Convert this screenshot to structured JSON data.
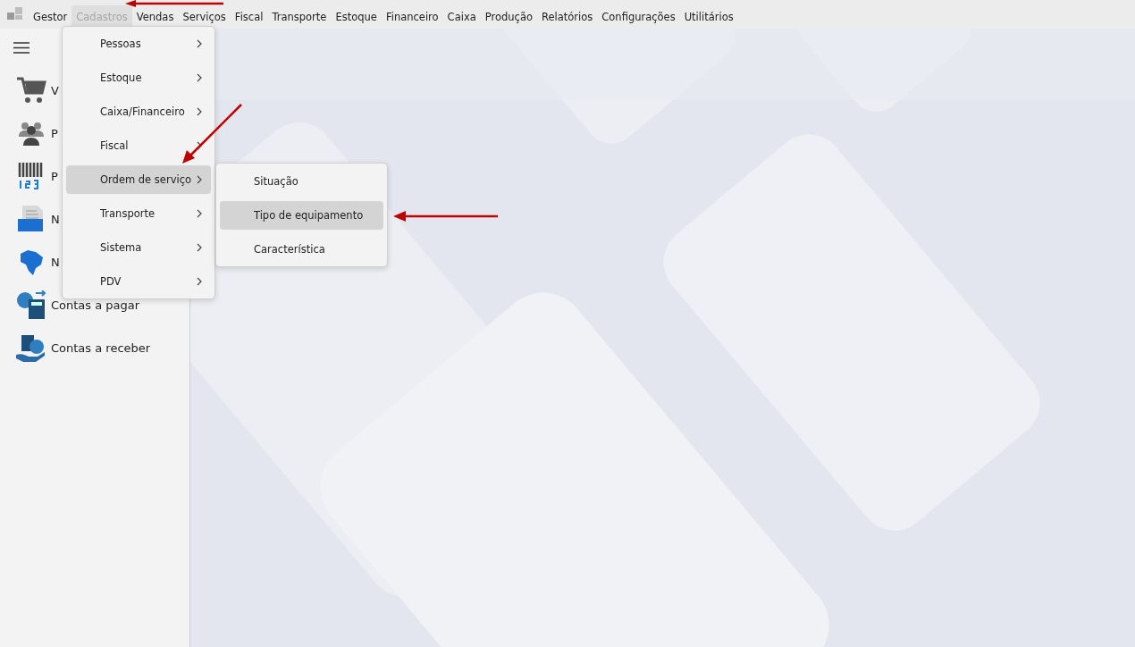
{
  "menu_bar": {
    "items": [
      {
        "label": "Gestor",
        "selected": false
      },
      {
        "label": "Cadastros",
        "selected": true
      },
      {
        "label": "Vendas",
        "selected": false
      },
      {
        "label": "Serviços",
        "selected": false
      },
      {
        "label": "Fiscal",
        "selected": false
      },
      {
        "label": "Transporte",
        "selected": false
      },
      {
        "label": "Estoque",
        "selected": false
      },
      {
        "label": "Financeiro",
        "selected": false
      },
      {
        "label": "Caixa",
        "selected": false
      },
      {
        "label": "Produção",
        "selected": false
      },
      {
        "label": "Relatórios",
        "selected": false
      },
      {
        "label": "Configurações",
        "selected": false
      },
      {
        "label": "Utilitários",
        "selected": false
      }
    ]
  },
  "sidebar": {
    "items": [
      {
        "label": "V",
        "kind": "cart"
      },
      {
        "label": "P",
        "kind": "people"
      },
      {
        "label": "P",
        "kind": "barcode"
      },
      {
        "label": "N",
        "kind": "nfse"
      },
      {
        "label": "N",
        "kind": "nfe"
      },
      {
        "label": "Contas a pagar",
        "kind": "pay"
      },
      {
        "label": "Contas a receber",
        "kind": "receive"
      }
    ]
  },
  "dropdown": {
    "items": [
      {
        "label": "Pessoas",
        "selected": false
      },
      {
        "label": "Estoque",
        "selected": false
      },
      {
        "label": "Caixa/Financeiro",
        "selected": false
      },
      {
        "label": "Fiscal",
        "selected": false
      },
      {
        "label": "Ordem de serviço",
        "selected": true
      },
      {
        "label": "Transporte",
        "selected": false
      },
      {
        "label": "Sistema",
        "selected": false
      },
      {
        "label": "PDV",
        "selected": false
      }
    ]
  },
  "submenu": {
    "items": [
      {
        "label": "Situação",
        "selected": false
      },
      {
        "label": "Tipo de equipamento",
        "selected": true
      },
      {
        "label": "Característica",
        "selected": false
      }
    ]
  }
}
